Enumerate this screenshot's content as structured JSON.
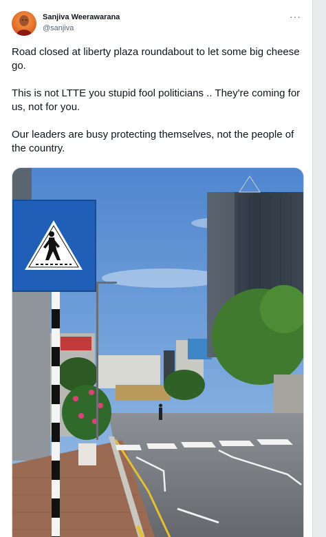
{
  "author": {
    "name": "Sanjiva Weerawarana",
    "handle": "@sanjiva"
  },
  "more_menu": {
    "label": "···"
  },
  "tweet": {
    "paragraphs": [
      "Road closed at liberty plaza roundabout to let some big cheese go.",
      "This is not LTTE you stupid fool politicians .. They're coming for us, not for you.",
      "Our leaders are busy protecting themselves, not the people of the country."
    ]
  },
  "colors": {
    "text_primary": "#0f1419",
    "text_secondary": "#536471",
    "sign_blue": "#1f5fb8",
    "sky": "#6d9ad2"
  },
  "icons": {
    "more": "more-horizontal-icon"
  }
}
